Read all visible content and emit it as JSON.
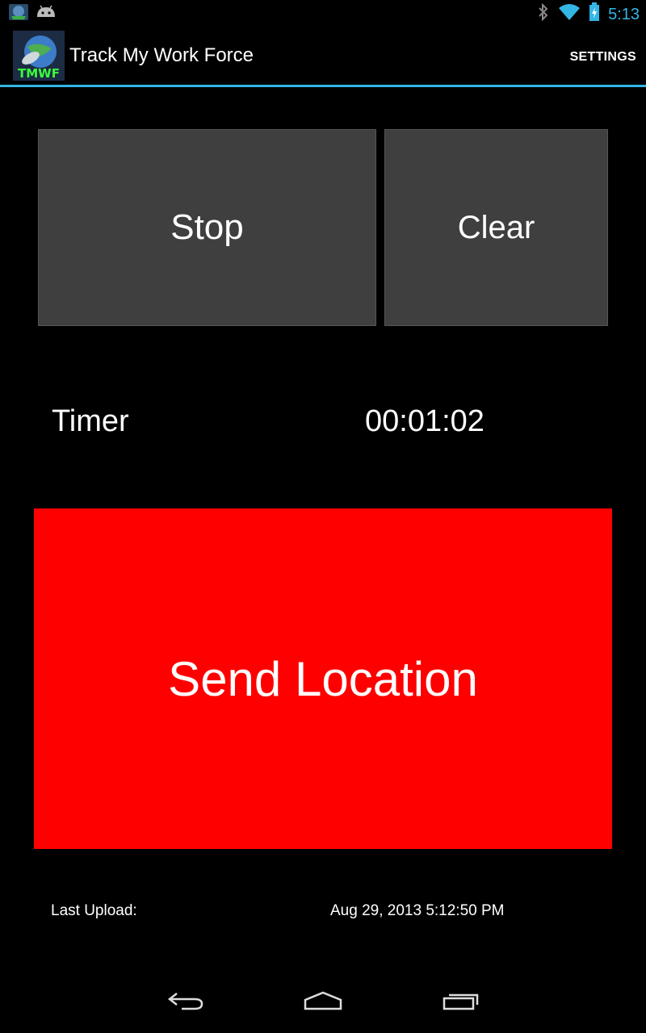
{
  "status_bar": {
    "time": "5:13",
    "icons": [
      "app-notification-icon",
      "android-icon",
      "bluetooth-icon",
      "wifi-icon",
      "battery-charging-icon"
    ]
  },
  "action_bar": {
    "title": "Track My Work Force",
    "logo_text": "TMWF",
    "settings_label": "SETTINGS"
  },
  "controls": {
    "stop_label": "Stop",
    "clear_label": "Clear"
  },
  "timer": {
    "label": "Timer",
    "value": "00:01:02"
  },
  "send_button": {
    "label": "Send Location",
    "color": "#ff0000"
  },
  "last_upload": {
    "label": "Last Upload:",
    "value": "Aug 29, 2013 5:12:50 PM"
  },
  "nav_bar": {
    "icons": [
      "back-icon",
      "home-icon",
      "recent-apps-icon"
    ]
  },
  "colors": {
    "accent": "#33b5e5",
    "button_gray": "#3f3f3f",
    "background": "#000000"
  }
}
